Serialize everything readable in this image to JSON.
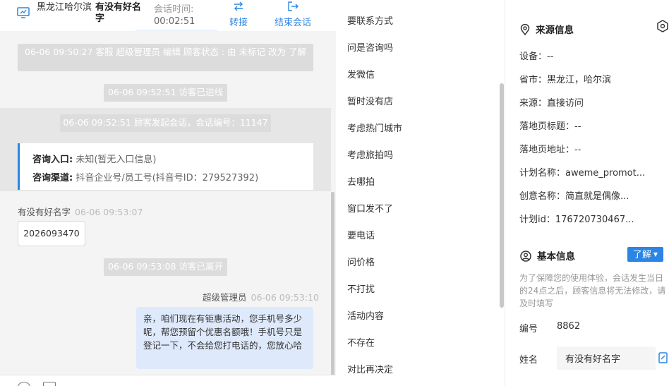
{
  "header": {
    "location": "黑龙江哈尔滨",
    "visitor_name": "有没有好名字",
    "time_label": "会话时间:",
    "time_value": "00:02:51",
    "transfer_label": "转接",
    "end_label": "结束会话"
  },
  "chat": {
    "system_messages": [
      "06-06 09:50:27 客服 超级管理员 编辑 顾客状态 : 由 未标记 改为 了解",
      "06-06 09:52:51 访客已进线",
      "06-06 09:52:51 顾客发起会话，会话编号：11147",
      "06-06 09:53:08 访客已离开"
    ],
    "info_card": {
      "entry_label": "咨询入口:",
      "entry_value": "未知(暂无入口信息)",
      "channel_label": "咨询渠道:",
      "channel_value": "抖音企业号/员工号(抖音号ID：279527392)"
    },
    "visitor_message": {
      "sender": "有没有好名字",
      "time": "06-06 09:53:07",
      "text": "2026093470"
    },
    "agent_message": {
      "sender": "超级管理员",
      "time": "06-06 09:53:10",
      "text": "亲，咱们现在有钜惠活动，您手机号多少呢，帮您预留个优惠名额哦！手机号只是登记一下，不会给您打电话的，您放心哈"
    }
  },
  "quick_replies": [
    "要联系方式",
    "问是咨询吗",
    "发微信",
    "暂时没有店",
    "考虑热门城市",
    "考虑旅拍吗",
    "去哪拍",
    "窗口发不了",
    "要电话",
    "问价格",
    "不打扰",
    "活动内容",
    "不存在",
    "对比再决定"
  ],
  "source_info": {
    "title": "来源信息",
    "device": "设备：--",
    "province_city": "省市：黑龙江，哈尔滨",
    "source": "来源：直接访问",
    "landing_title": "落地页标题：--",
    "landing_url": "落地页地址：--",
    "plan_name": "计划名称：aweme_promot...",
    "creative_name": "创意名称：简直就是偶像...",
    "plan_id": "计划id：176720730467..."
  },
  "basic_info": {
    "title": "基本信息",
    "status_button": "了解",
    "note": "为了保障您的使用体验，会话发生当日的24点之后，顾客信息将无法修改，请及时填写",
    "id_label": "编号",
    "id_value": "8862",
    "name_label": "姓名",
    "name_value": "有没有好名字"
  },
  "colors": {
    "accent": "#2b85e4",
    "system_bubble": "#dcdcdc",
    "agent_bubble": "#deeafb",
    "chat_bg": "#f4f4f5"
  }
}
